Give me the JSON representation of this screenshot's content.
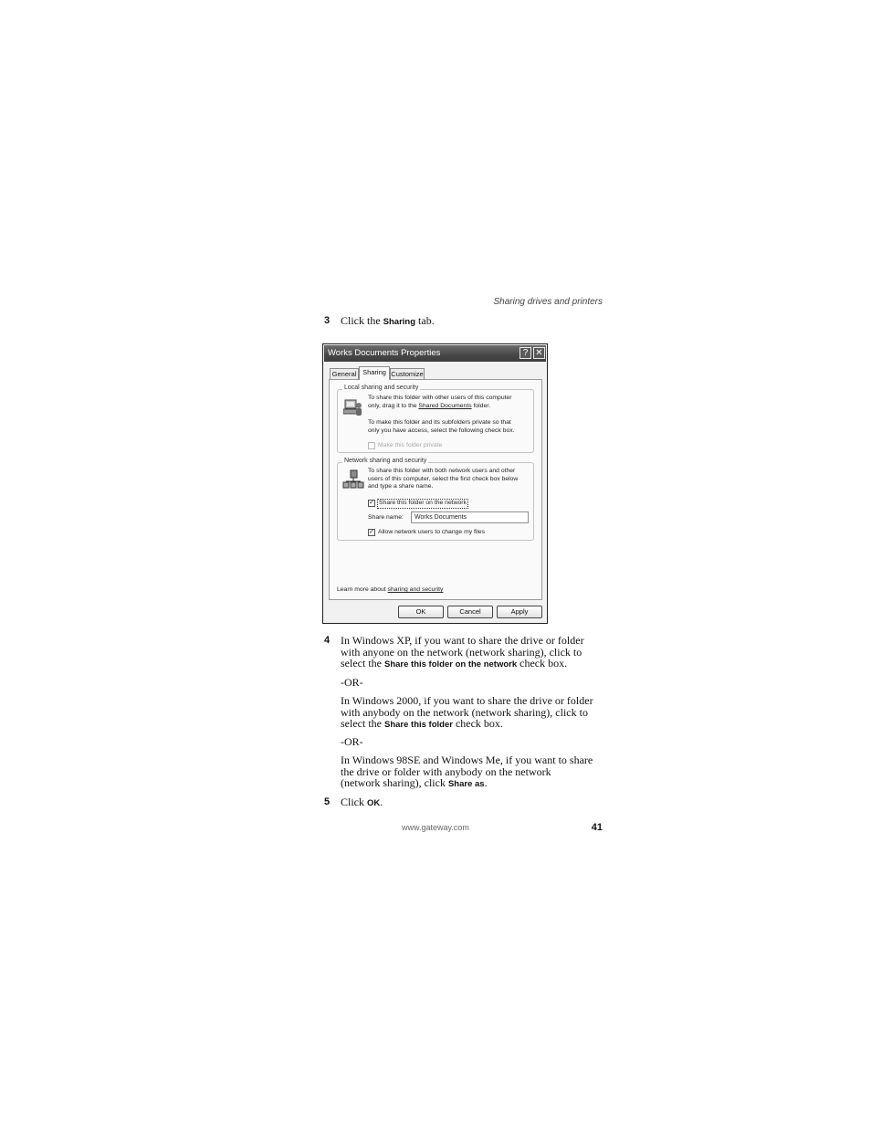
{
  "header": {
    "running_head": "Sharing drives and printers"
  },
  "steps": {
    "s3": {
      "num": "3",
      "pre": "Click the ",
      "term": "Sharing",
      "post": " tab."
    },
    "s4": {
      "num": "4",
      "xp_line1": "In Windows XP, if you want to share the drive or folder",
      "xp_line2": "with anyone on the network (network sharing), click to",
      "xp_line3_pre": "select the ",
      "xp_term": "Share this folder on the network",
      "xp_line3_post": " check box.",
      "or1": "-OR-",
      "w2k_line1": "In Windows 2000, if you want to share the drive or folder",
      "w2k_line2": "with anybody on the network (network sharing), click to",
      "w2k_line3_pre": "select the ",
      "w2k_term": "Share this folder",
      "w2k_line3_post": " check box.",
      "or2": "-OR-",
      "w98_line1": "In Windows 98SE and Windows Me, if you want to share",
      "w98_line2": "the drive or folder with anybody on the network",
      "w98_line3_pre": "(network sharing), click ",
      "w98_term": "Share as",
      "w98_line3_post": "."
    },
    "s5": {
      "num": "5",
      "pre": "Click ",
      "term": "OK",
      "post": "."
    }
  },
  "dialog": {
    "title": "Works Documents Properties",
    "help_label": "?",
    "close_label": "✕",
    "tabs": [
      "General",
      "Sharing",
      "Customize"
    ],
    "local_group": {
      "legend": "Local sharing and security",
      "text1_line1": "To share this folder with other users of this computer",
      "text1_line2_pre": "only, drag it to the ",
      "text1_link": "Shared Documents",
      "text1_line2_post": " folder.",
      "text2_line1": "To make this folder and its subfolders private so that",
      "text2_line2": "only you have access, select the following check box.",
      "private_label": "Make this folder private"
    },
    "network_group": {
      "legend": "Network sharing and security",
      "text_line1": "To share this folder with both network users and other",
      "text_line2": "users of this computer, select the first check box below",
      "text_line3": "and type a share name.",
      "share_label": "Share this folder on the network",
      "share_name_label": "Share name:",
      "share_name_value": "Works Documents",
      "allow_label": "Allow network users to change my files"
    },
    "learn_more_pre": "Learn more about ",
    "learn_more_link": "sharing and security",
    "buttons": {
      "ok": "OK",
      "cancel": "Cancel",
      "apply": "Apply"
    }
  },
  "footer": {
    "url": "www.gateway.com",
    "page_number": "41"
  }
}
